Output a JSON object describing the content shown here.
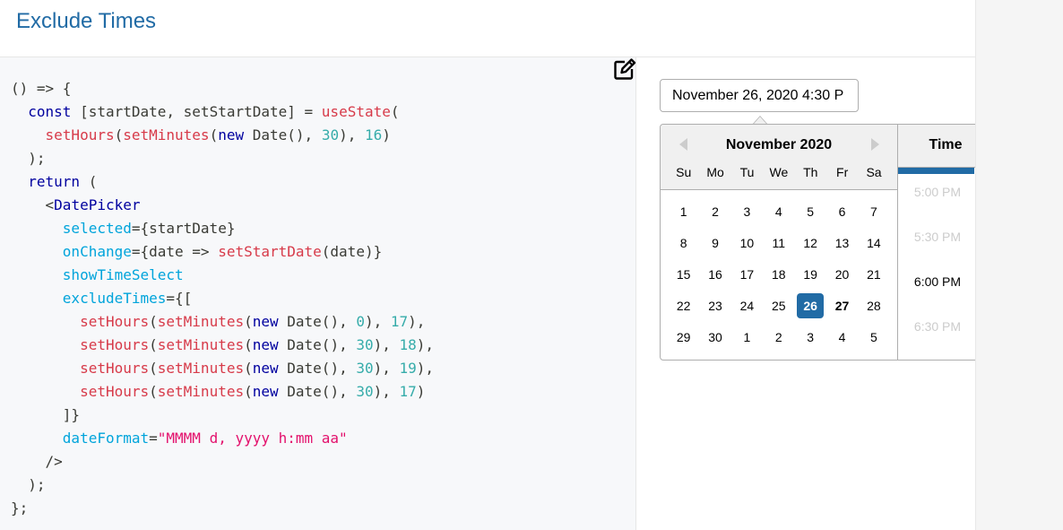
{
  "page": {
    "title": "Exclude Times"
  },
  "code": {
    "lines": [
      [
        {
          "t": "() => {",
          "c": ""
        }
      ],
      [
        {
          "t": "  ",
          "c": ""
        },
        {
          "t": "const",
          "c": "kw"
        },
        {
          "t": " [startDate, setStartDate] = ",
          "c": ""
        },
        {
          "t": "useState",
          "c": "fn"
        },
        {
          "t": "(",
          "c": ""
        }
      ],
      [
        {
          "t": "    ",
          "c": ""
        },
        {
          "t": "setHours",
          "c": "fn"
        },
        {
          "t": "(",
          "c": ""
        },
        {
          "t": "setMinutes",
          "c": "fn"
        },
        {
          "t": "(",
          "c": ""
        },
        {
          "t": "new",
          "c": "kw"
        },
        {
          "t": " Date(), ",
          "c": ""
        },
        {
          "t": "30",
          "c": "num"
        },
        {
          "t": "), ",
          "c": ""
        },
        {
          "t": "16",
          "c": "num"
        },
        {
          "t": ")",
          "c": ""
        }
      ],
      [
        {
          "t": "  );",
          "c": ""
        }
      ],
      [
        {
          "t": "  ",
          "c": ""
        },
        {
          "t": "return",
          "c": "kw"
        },
        {
          "t": " (",
          "c": ""
        }
      ],
      [
        {
          "t": "    <",
          "c": ""
        },
        {
          "t": "DatePicker",
          "c": "tag"
        }
      ],
      [
        {
          "t": "      ",
          "c": ""
        },
        {
          "t": "selected",
          "c": "attr"
        },
        {
          "t": "={startDate}",
          "c": ""
        }
      ],
      [
        {
          "t": "      ",
          "c": ""
        },
        {
          "t": "onChange",
          "c": "attr"
        },
        {
          "t": "={date => ",
          "c": ""
        },
        {
          "t": "setStartDate",
          "c": "fn"
        },
        {
          "t": "(date)}",
          "c": ""
        }
      ],
      [
        {
          "t": "      ",
          "c": ""
        },
        {
          "t": "showTimeSelect",
          "c": "attr"
        }
      ],
      [
        {
          "t": "      ",
          "c": ""
        },
        {
          "t": "excludeTimes",
          "c": "attr"
        },
        {
          "t": "={[",
          "c": ""
        }
      ],
      [
        {
          "t": "        ",
          "c": ""
        },
        {
          "t": "setHours",
          "c": "fn"
        },
        {
          "t": "(",
          "c": ""
        },
        {
          "t": "setMinutes",
          "c": "fn"
        },
        {
          "t": "(",
          "c": ""
        },
        {
          "t": "new",
          "c": "kw"
        },
        {
          "t": " Date(), ",
          "c": ""
        },
        {
          "t": "0",
          "c": "num"
        },
        {
          "t": "), ",
          "c": ""
        },
        {
          "t": "17",
          "c": "num"
        },
        {
          "t": "),",
          "c": ""
        }
      ],
      [
        {
          "t": "        ",
          "c": ""
        },
        {
          "t": "setHours",
          "c": "fn"
        },
        {
          "t": "(",
          "c": ""
        },
        {
          "t": "setMinutes",
          "c": "fn"
        },
        {
          "t": "(",
          "c": ""
        },
        {
          "t": "new",
          "c": "kw"
        },
        {
          "t": " Date(), ",
          "c": ""
        },
        {
          "t": "30",
          "c": "num"
        },
        {
          "t": "), ",
          "c": ""
        },
        {
          "t": "18",
          "c": "num"
        },
        {
          "t": "),",
          "c": ""
        }
      ],
      [
        {
          "t": "        ",
          "c": ""
        },
        {
          "t": "setHours",
          "c": "fn"
        },
        {
          "t": "(",
          "c": ""
        },
        {
          "t": "setMinutes",
          "c": "fn"
        },
        {
          "t": "(",
          "c": ""
        },
        {
          "t": "new",
          "c": "kw"
        },
        {
          "t": " Date(), ",
          "c": ""
        },
        {
          "t": "30",
          "c": "num"
        },
        {
          "t": "), ",
          "c": ""
        },
        {
          "t": "19",
          "c": "num"
        },
        {
          "t": "),",
          "c": ""
        }
      ],
      [
        {
          "t": "        ",
          "c": ""
        },
        {
          "t": "setHours",
          "c": "fn"
        },
        {
          "t": "(",
          "c": ""
        },
        {
          "t": "setMinutes",
          "c": "fn"
        },
        {
          "t": "(",
          "c": ""
        },
        {
          "t": "new",
          "c": "kw"
        },
        {
          "t": " Date(), ",
          "c": ""
        },
        {
          "t": "30",
          "c": "num"
        },
        {
          "t": "), ",
          "c": ""
        },
        {
          "t": "17",
          "c": "num"
        },
        {
          "t": ")",
          "c": ""
        }
      ],
      [
        {
          "t": "      ]}",
          "c": ""
        }
      ],
      [
        {
          "t": "      ",
          "c": ""
        },
        {
          "t": "dateFormat",
          "c": "attr"
        },
        {
          "t": "=",
          "c": ""
        },
        {
          "t": "\"MMMM d, yyyy h:mm aa\"",
          "c": "str"
        }
      ],
      [
        {
          "t": "    />",
          "c": ""
        }
      ],
      [
        {
          "t": "  );",
          "c": ""
        }
      ],
      [
        {
          "t": "};",
          "c": ""
        }
      ]
    ]
  },
  "edit_icon": "edit-icon",
  "datepicker": {
    "input_value": "November 26, 2020 4:30 P",
    "month_title": "November 2020",
    "weekdays": [
      "Su",
      "Mo",
      "Tu",
      "We",
      "Th",
      "Fr",
      "Sa"
    ],
    "weeks": [
      [
        "1",
        "2",
        "3",
        "4",
        "5",
        "6",
        "7"
      ],
      [
        "8",
        "9",
        "10",
        "11",
        "12",
        "13",
        "14"
      ],
      [
        "15",
        "16",
        "17",
        "18",
        "19",
        "20",
        "21"
      ],
      [
        "22",
        "23",
        "24",
        "25",
        "26",
        "27",
        "28"
      ],
      [
        "29",
        "30",
        "1",
        "2",
        "3",
        "4",
        "5"
      ]
    ],
    "selected_day": "26",
    "today_day": "27",
    "time_title": "Time",
    "times": [
      {
        "label": "5:00 PM",
        "disabled": true
      },
      {
        "label": "5:30 PM",
        "disabled": true
      },
      {
        "label": "6:00 PM",
        "disabled": false
      },
      {
        "label": "6:30 PM",
        "disabled": true
      }
    ],
    "accent_color": "#216ba5"
  }
}
